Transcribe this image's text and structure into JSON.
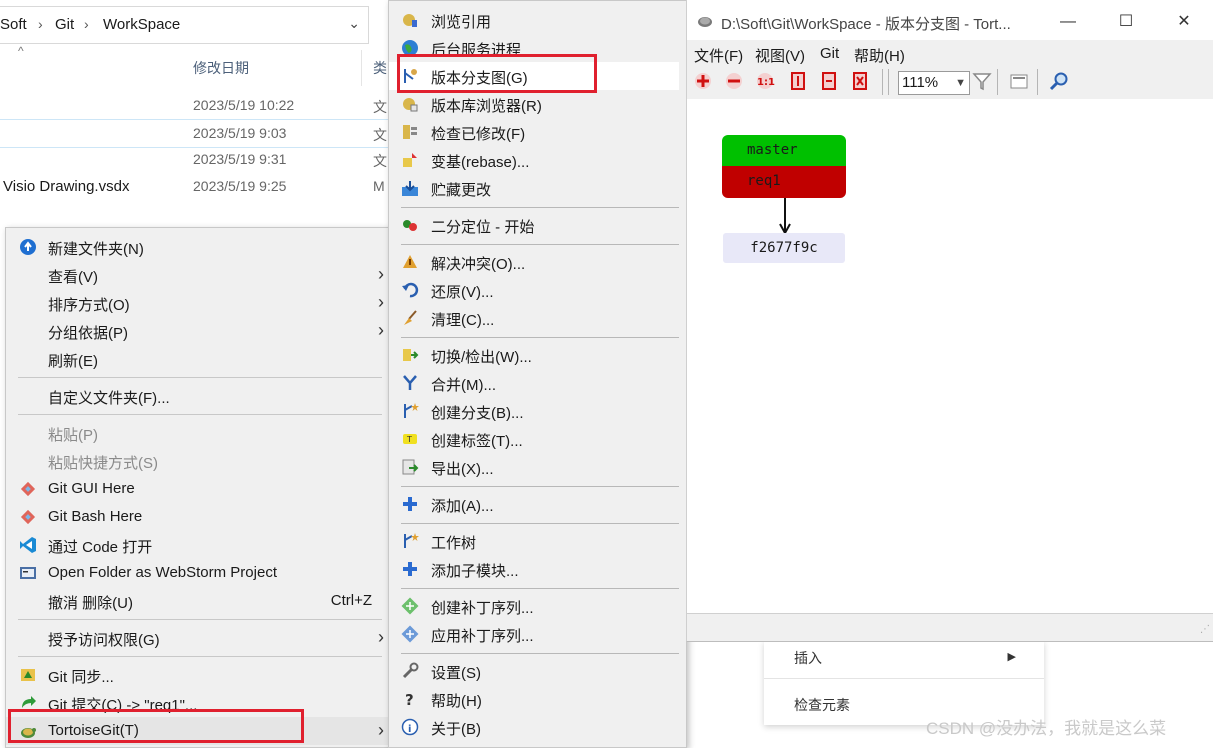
{
  "explorer": {
    "breadcrumb": [
      "Soft",
      "Git",
      "WorkSpace"
    ],
    "columns": {
      "modified": "修改日期",
      "type": "类"
    },
    "files": [
      {
        "name": "",
        "date": "2023/5/19 10:22",
        "type": "文"
      },
      {
        "name": "",
        "date": "2023/5/19 9:03",
        "type": "文"
      },
      {
        "name": "",
        "date": "2023/5/19 9:31",
        "type": "文"
      },
      {
        "name": "Visio Drawing.vsdx",
        "date": "2023/5/19 9:25",
        "type": "M"
      }
    ]
  },
  "context_menu": {
    "items": [
      {
        "label": "新建文件夹(N)",
        "icon": "new-folder-icon"
      },
      {
        "label": "查看(V)",
        "submenu": true
      },
      {
        "label": "排序方式(O)",
        "submenu": true
      },
      {
        "label": "分组依据(P)",
        "submenu": true
      },
      {
        "label": "刷新(E)"
      },
      {
        "label": "自定义文件夹(F)..."
      },
      {
        "label": "粘贴(P)",
        "disabled": true
      },
      {
        "label": "粘贴快捷方式(S)",
        "disabled": true
      },
      {
        "label": "Git GUI Here",
        "icon": "git-icon"
      },
      {
        "label": "Git Bash Here",
        "icon": "git-icon"
      },
      {
        "label": "通过 Code 打开",
        "icon": "vscode-icon"
      },
      {
        "label": "Open Folder as WebStorm Project",
        "icon": "webstorm-icon"
      },
      {
        "label": "撤消 删除(U)",
        "shortcut": "Ctrl+Z"
      },
      {
        "label": "授予访问权限(G)",
        "submenu": true
      },
      {
        "label": "Git 同步...",
        "icon": "git-sync-icon"
      },
      {
        "label": "Git 提交(C) -> \"req1\"...",
        "icon": "git-commit-icon"
      },
      {
        "label": "TortoiseGit(T)",
        "icon": "tortoisegit-icon",
        "submenu": true
      }
    ]
  },
  "tortoise_menu": {
    "items": [
      {
        "label": "浏览引用"
      },
      {
        "label": "后台服务进程"
      },
      {
        "label": "版本分支图(G)",
        "highlighted": true
      },
      {
        "label": "版本库浏览器(R)"
      },
      {
        "label": "检查已修改(F)"
      },
      {
        "label": "变基(rebase)..."
      },
      {
        "label": "贮藏更改"
      },
      {
        "label": "二分定位 - 开始"
      },
      {
        "label": "解决冲突(O)..."
      },
      {
        "label": "还原(V)..."
      },
      {
        "label": "清理(C)..."
      },
      {
        "label": "切换/检出(W)..."
      },
      {
        "label": "合并(M)..."
      },
      {
        "label": "创建分支(B)..."
      },
      {
        "label": "创建标签(T)..."
      },
      {
        "label": "导出(X)..."
      },
      {
        "label": "添加(A)..."
      },
      {
        "label": "工作树"
      },
      {
        "label": "添加子模块..."
      },
      {
        "label": "创建补丁序列..."
      },
      {
        "label": "应用补丁序列..."
      },
      {
        "label": "设置(S)"
      },
      {
        "label": "帮助(H)"
      },
      {
        "label": "关于(B)"
      }
    ]
  },
  "revision_graph": {
    "title": "D:\\Soft\\Git\\WorkSpace - 版本分支图 - Tort...",
    "menu": [
      "文件(F)",
      "视图(V)",
      "Git",
      "帮助(H)"
    ],
    "zoom": "111%",
    "nodes": {
      "branch1": "master",
      "branch2": "req1",
      "commit": "f2677f9c"
    },
    "colors": {
      "master": "#00c000",
      "req1": "#c00000",
      "commit": "#e8e8f8"
    }
  },
  "browser_menu": {
    "items": [
      "插入",
      "检查元素"
    ]
  },
  "watermark": "CSDN @没办法，我就是这么菜"
}
